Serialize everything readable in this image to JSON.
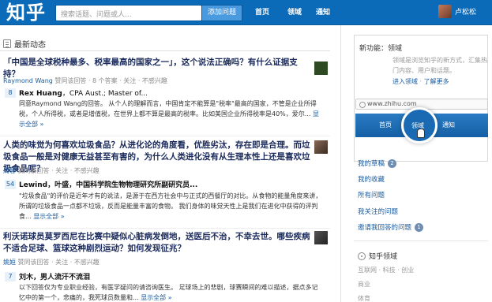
{
  "header": {
    "logo": "知乎",
    "search_placeholder": "搜索话题、问题或人...",
    "ask_button": "添加问题",
    "nav": [
      "首页",
      "领域",
      "通知"
    ],
    "username": "卢松松"
  },
  "feed": {
    "section_title": "最新动态",
    "items": [
      {
        "title": "「中国是全球税种最多、税率最高的国家之一」，这个说法正确吗？有什么证据支持？",
        "meta_user": "Raymond Wang",
        "meta_rest": " 赞同该回答 · 8 个答案 · 关注 · 不感兴趣",
        "votes": "8",
        "answerer_name": "Rex Huang",
        "answerer_bio": "，CPA Aust.; Master of...",
        "answer": "同意Raymond Wang的回答。 从个人的理解而言，中国肯定不能算是\"税率\"最高的国家，不管是企业所得税，个人所得税，或者是增值税，在世界上都不算是最高的税率。比如美国企业所得税率是40%，爱尔...",
        "more": "显示全部 »"
      },
      {
        "title": "人类的味觉为何喜欢垃圾食品？从进化论的角度看，优胜劣汰，存在即是合理。而垃圾食品一般是对健康无益甚至有害的，为什么人类进化没有从生理本性上还是喜欢垃圾食品呢？",
        "meta_user": "周蓉",
        "meta_rest": " 赞同该回答 · 关注 · 不感兴趣",
        "votes": "54",
        "answerer_name": "Lewind",
        "answerer_bio": "，叶盛，中国科学院生物物理研究所副研究员...",
        "answer": "\"垃圾食品\"的评价是近年才有的说法，是源于在西方社会中与正式的西餐厅的对比。从食物的能量角度来讲，所谓的垃圾食品一点都不垃圾，反而是能量丰富的食物。 我们身体的味觉天性上是我们在进化中获得的评判食...",
        "more": "显示全部 »"
      },
      {
        "title": "利沃诺球员莫罗西尼在比赛中疑似心脏病发倒地，送医后不治，不幸去世。哪些疾病不适合足球、篮球这种剧烈运动？如何发现征兆？",
        "meta_user": "姚姮",
        "meta_rest": " 赞同该回答 · 关注 · 不感兴趣",
        "votes": "7",
        "answerer_name": "刘木",
        "answerer_bio": "，男人流汗不流泪",
        "answer": "以下回答仅为专业职业经验，有医学疑问的请咨询医生。 足球场上的悲剧，球赛瞬间的难以描述，据点多记忆中的第一个，悲痛的，我死球员数量和...",
        "more": "显示全部 »"
      }
    ]
  },
  "sidebar": {
    "promo": {
      "title": "新功能：领域",
      "desc": "领域是浏览知乎的新方式，汇集热门内容、用户和话题。",
      "link_enter": "进入领域",
      "link_learn": "了解更多",
      "url": "www.zhihu.com",
      "bar": [
        "首页",
        "领域",
        "通知"
      ]
    },
    "links": [
      {
        "label": "我的草稿",
        "badge": "2"
      },
      {
        "label": "我的收藏",
        "badge": ""
      },
      {
        "label": "所有问题",
        "badge": ""
      },
      {
        "label": "我关注的问题",
        "badge": ""
      },
      {
        "label": "邀请我回答的问题",
        "badge": "1"
      }
    ],
    "areas_title": "知乎领域",
    "areas": [
      "互联网 · 科技 · 创业",
      "商业",
      "体育"
    ]
  },
  "colors": {
    "topbar": "#0c6bb8",
    "link": "#1a5ca0",
    "title": "#1a2a5c"
  }
}
